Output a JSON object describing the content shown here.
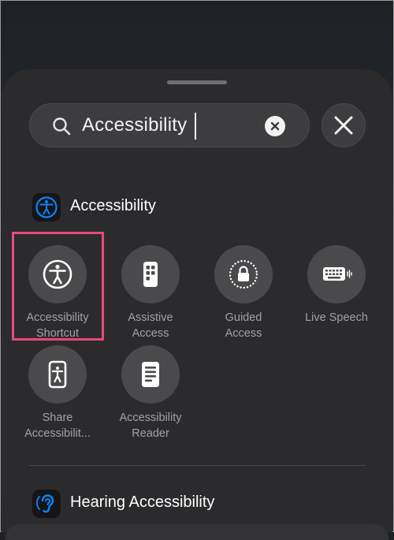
{
  "search": {
    "value": "Accessibility"
  },
  "sections": [
    {
      "title": "Accessibility",
      "controls": [
        {
          "line1": "Accessibility",
          "line2": "Shortcut",
          "icon": "accessibility-shortcut-icon",
          "highlighted": true
        },
        {
          "line1": "Assistive",
          "line2": "Access",
          "icon": "assistive-access-icon"
        },
        {
          "line1": "Guided",
          "line2": "Access",
          "icon": "guided-access-icon"
        },
        {
          "line1": "Live Speech",
          "line2": "",
          "icon": "live-speech-icon"
        },
        {
          "line1": "Share",
          "line2": "Accessibilit...",
          "icon": "share-accessibility-icon"
        },
        {
          "line1": "Accessibility",
          "line2": "Reader",
          "icon": "accessibility-reader-icon"
        }
      ]
    },
    {
      "title": "Hearing Accessibility"
    }
  ],
  "colors": {
    "sheet": "#2b2b2d",
    "control_circle": "#4a4a4c",
    "highlight": "#e8497a",
    "accessibility_blue": "#0a84ff"
  }
}
